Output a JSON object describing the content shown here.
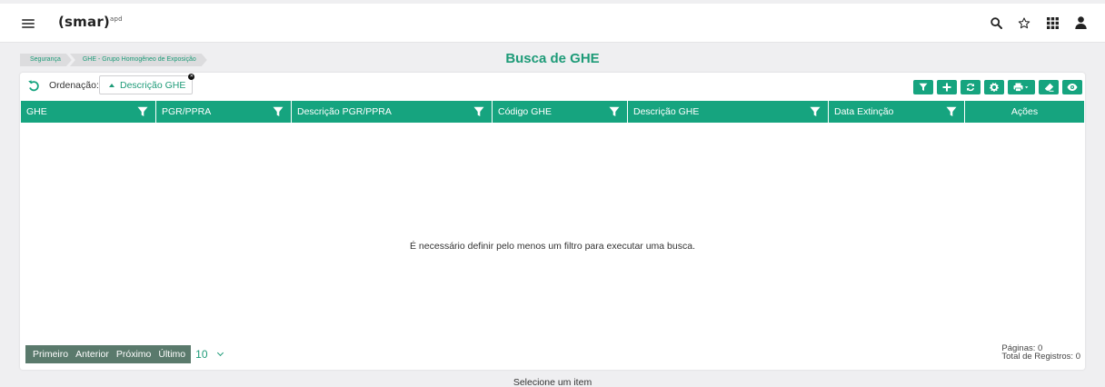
{
  "header": {
    "logo_text": "(smar)",
    "logo_sup": "apd",
    "icons": [
      "search-icon",
      "star-icon",
      "apps-grid-icon",
      "user-icon"
    ]
  },
  "breadcrumb": [
    "Segurança",
    "GHE - Grupo Homogêneo de Exposição"
  ],
  "page_title": "Busca de GHE",
  "sort": {
    "label": "Ordenação:",
    "value": "Descrição GHE",
    "direction": "ascending"
  },
  "toolbar": {
    "buttons": [
      "filter-icon",
      "add-icon",
      "refresh-icon",
      "settings-icon",
      "print-dropdown-icon",
      "eraser-icon",
      "view-icon"
    ]
  },
  "table": {
    "columns": [
      "GHE",
      "PGR/PPRA",
      "Descrição PGR/PPRA",
      "Código GHE",
      "Descrição GHE",
      "Data Extinção",
      "Ações"
    ],
    "empty_message": "É necessário definir pelo menos um filtro para executar uma busca."
  },
  "pager": {
    "first": "Primeiro",
    "previous": "Anterior",
    "next": "Próximo",
    "last": "Último",
    "page_size": "10"
  },
  "page_info": {
    "pages": "Páginas: 0",
    "total": "Total de Registros: 0"
  },
  "footer_message": "Selecione um item",
  "colors": {
    "accent": "#16a47f",
    "title": "#1e9b78",
    "pager_bg": "#5a7a6c"
  }
}
